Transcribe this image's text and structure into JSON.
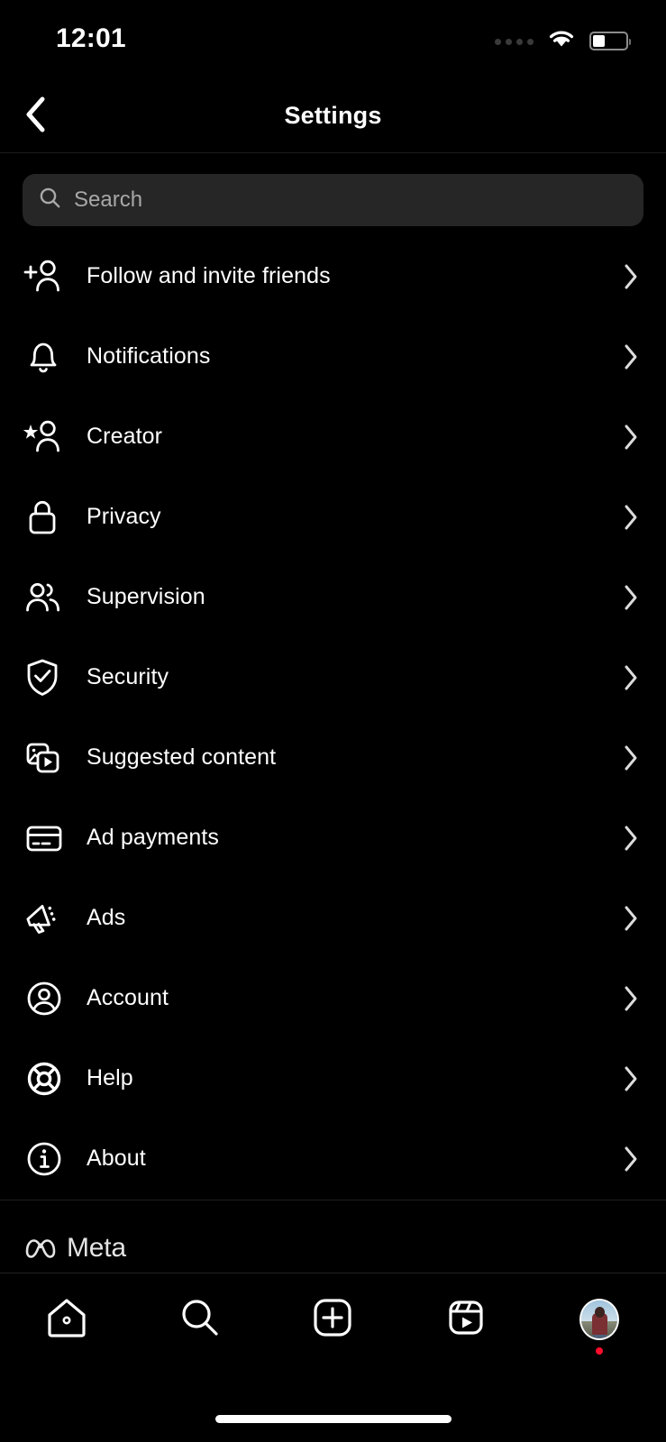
{
  "status_bar": {
    "time": "12:01",
    "cellular_icon": "cellular-dots-icon",
    "wifi_icon": "wifi-icon",
    "battery_icon": "battery-icon"
  },
  "header": {
    "back_icon": "chevron-left-icon",
    "title": "Settings"
  },
  "search": {
    "icon": "search-icon",
    "value": "",
    "placeholder": "Search"
  },
  "settings_list": [
    {
      "label": "Follow and invite friends",
      "icon": "person-plus-icon",
      "chevron": "chevron-right-icon"
    },
    {
      "label": "Notifications",
      "icon": "bell-icon",
      "chevron": "chevron-right-icon"
    },
    {
      "label": "Creator",
      "icon": "person-star-icon",
      "chevron": "chevron-right-icon"
    },
    {
      "label": "Privacy",
      "icon": "lock-icon",
      "chevron": "chevron-right-icon"
    },
    {
      "label": "Supervision",
      "icon": "people-icon",
      "chevron": "chevron-right-icon"
    },
    {
      "label": "Security",
      "icon": "shield-check-icon",
      "chevron": "chevron-right-icon"
    },
    {
      "label": "Suggested content",
      "icon": "media-stack-play-icon",
      "chevron": "chevron-right-icon"
    },
    {
      "label": "Ad payments",
      "icon": "credit-card-icon",
      "chevron": "chevron-right-icon"
    },
    {
      "label": "Ads",
      "icon": "megaphone-icon",
      "chevron": "chevron-right-icon"
    },
    {
      "label": "Account",
      "icon": "account-circle-icon",
      "chevron": "chevron-right-icon"
    },
    {
      "label": "Help",
      "icon": "life-ring-icon",
      "chevron": "chevron-right-icon"
    },
    {
      "label": "About",
      "icon": "info-circle-icon",
      "chevron": "chevron-right-icon"
    }
  ],
  "branding": {
    "logo_icon": "meta-infinity-icon",
    "name": "Meta"
  },
  "tab_bar": [
    {
      "name": "home",
      "icon": "home-icon"
    },
    {
      "name": "search",
      "icon": "search-icon"
    },
    {
      "name": "create",
      "icon": "plus-square-icon"
    },
    {
      "name": "reels",
      "icon": "reels-icon"
    },
    {
      "name": "profile",
      "icon": "profile-avatar-icon"
    }
  ],
  "colors": {
    "background": "#000000",
    "search_field": "#262626",
    "placeholder": "#a8a8a8",
    "divider": "#1f1f1f",
    "badge": "#ff0d2b"
  }
}
